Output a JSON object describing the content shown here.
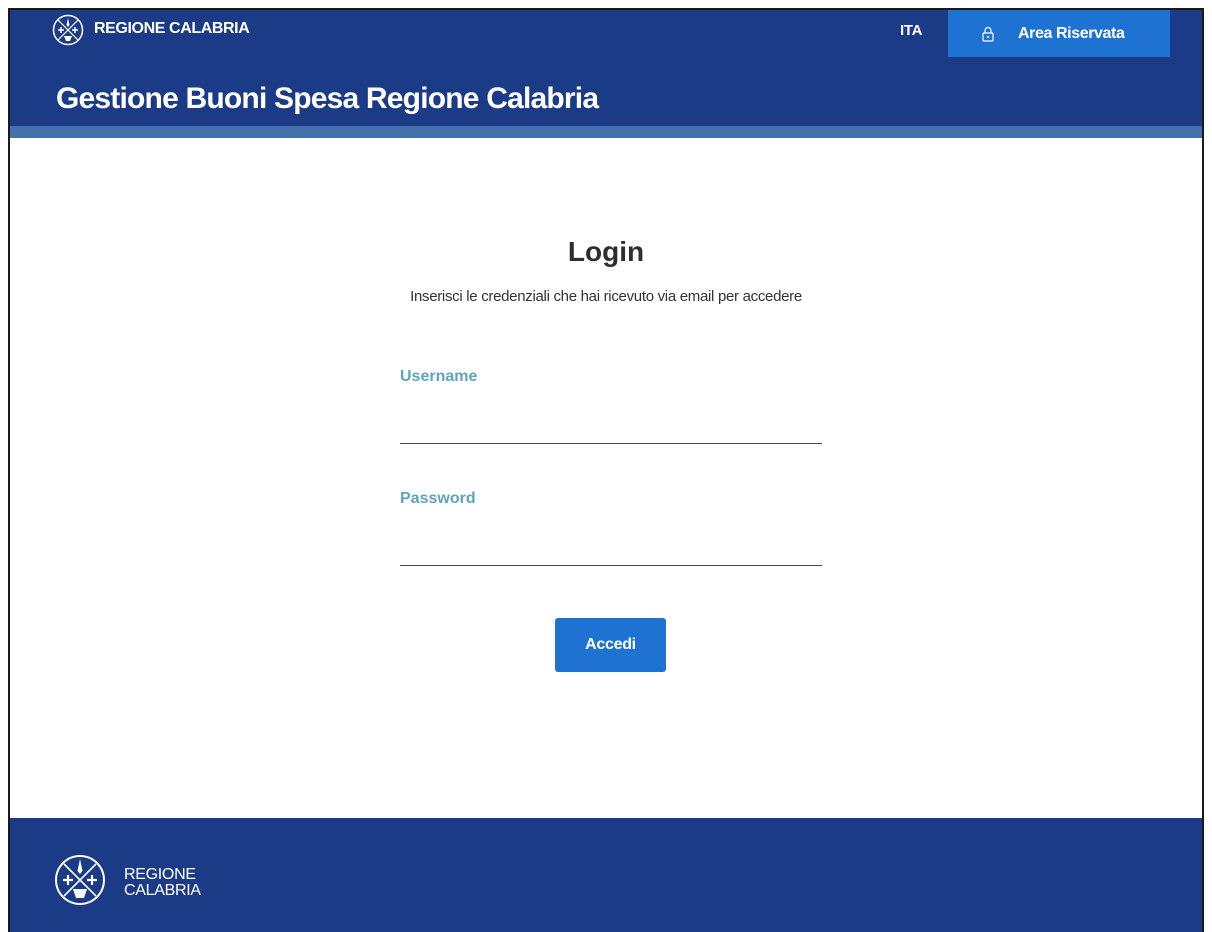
{
  "header": {
    "brand": "REGIONE CALABRIA",
    "language": "ITA",
    "reserved_area": "Area Riservata",
    "site_title": "Gestione Buoni Spesa Regione Calabria"
  },
  "login": {
    "title": "Login",
    "subtitle": "Inserisci le credenziali che hai ricevuto via email per accedere",
    "username_label": "Username",
    "username_value": "",
    "password_label": "Password",
    "password_value": "",
    "submit_label": "Accedi"
  },
  "footer": {
    "brand_line1": "REGIONE",
    "brand_line2": "CALABRIA"
  },
  "icons": {
    "logo": "regione-calabria-emblem-icon",
    "lock": "lock-icon"
  },
  "colors": {
    "header_bg": "#1b3b87",
    "header_stripe": "#4471ad",
    "accent_button": "#1e73d2",
    "field_label": "#5fa4bd"
  }
}
